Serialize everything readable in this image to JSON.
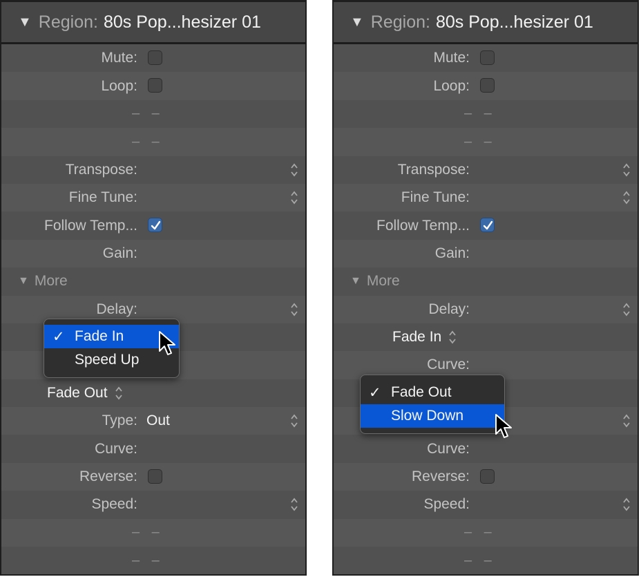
{
  "left_panel": {
    "header": {
      "label": "Region:",
      "name": "80s Pop...hesizer 01"
    },
    "rows": {
      "mute": "Mute:",
      "loop": "Loop:",
      "dash": "– –",
      "transpose": "Transpose:",
      "fine_tune": "Fine Tune:",
      "follow_tempo": "Follow Temp...",
      "gain": "Gain:",
      "more": "More",
      "delay": "Delay:",
      "fade_out_popup": "Fade Out",
      "type": "Type:",
      "type_value": "Out",
      "curve": "Curve:",
      "reverse": "Reverse:",
      "speed": "Speed:"
    },
    "checkboxes": {
      "mute": false,
      "loop": false,
      "follow_tempo": true,
      "reverse": false
    },
    "menu": {
      "items": [
        {
          "label": "Fade In",
          "checked": true,
          "highlighted": true
        },
        {
          "label": "Speed Up",
          "checked": false,
          "highlighted": false
        }
      ]
    }
  },
  "right_panel": {
    "header": {
      "label": "Region:",
      "name": "80s Pop...hesizer 01"
    },
    "rows": {
      "mute": "Mute:",
      "loop": "Loop:",
      "dash": "– –",
      "transpose": "Transpose:",
      "fine_tune": "Fine Tune:",
      "follow_tempo": "Follow Temp...",
      "gain": "Gain:",
      "more": "More",
      "delay": "Delay:",
      "fade_in_popup": "Fade In",
      "curve": "Curve:",
      "reverse": "Reverse:",
      "speed": "Speed:"
    },
    "checkboxes": {
      "mute": false,
      "loop": false,
      "follow_tempo": true,
      "reverse": false
    },
    "menu": {
      "items": [
        {
          "label": "Fade Out",
          "checked": true,
          "highlighted": false
        },
        {
          "label": "Slow Down",
          "checked": false,
          "highlighted": true
        }
      ]
    }
  },
  "icons": {
    "checkmark": "✓",
    "disclosure": "▼"
  }
}
